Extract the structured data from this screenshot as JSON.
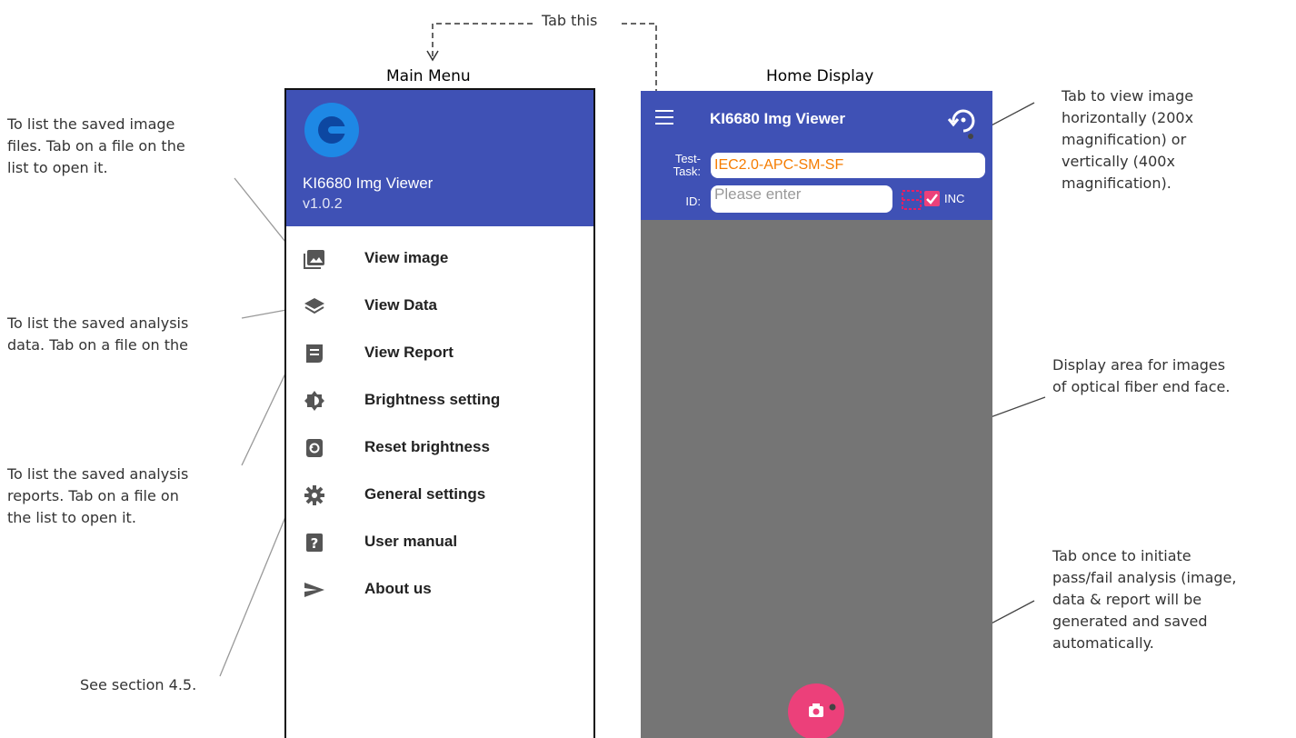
{
  "annotations": {
    "tab_this": "Tab this",
    "left_note_image": [
      "To list the saved image",
      "files. Tab on a file on the",
      "list to open it."
    ],
    "left_note_data": [
      "To list the saved analysis",
      "data. Tab on a file on the"
    ],
    "left_note_report": [
      "To list the saved analysis",
      "reports. Tab on a file on",
      "the list to open it."
    ],
    "left_note_section": "See section 4.5.",
    "right_note_rotate": [
      "Tab to view image",
      "horizontally (200x",
      "magnification) or",
      "vertically (400x",
      "magnification)."
    ],
    "right_note_display": [
      "Display area for images",
      "of optical fiber end face."
    ],
    "right_note_capture": [
      "Tab once to initiate",
      "pass/fail analysis (image,",
      "data & report will be",
      "generated and saved",
      "automatically."
    ]
  },
  "captions": {
    "main_menu": "Main Menu",
    "home_display": "Home Display"
  },
  "menu": {
    "app_name": "KI6680 Img Viewer",
    "version": "v1.0.2",
    "items": [
      {
        "label": "View image",
        "icon": "image-icon"
      },
      {
        "label": "View Data",
        "icon": "layers-icon"
      },
      {
        "label": "View Report",
        "icon": "report-icon"
      },
      {
        "label": "Brightness setting",
        "icon": "brightness-icon"
      },
      {
        "label": "Reset brightness",
        "icon": "reset-brightness-icon"
      },
      {
        "label": "General settings",
        "icon": "gear-icon"
      },
      {
        "label": "User manual",
        "icon": "help-icon"
      },
      {
        "label": "About us",
        "icon": "send-icon"
      }
    ]
  },
  "home": {
    "title": "KI6680 Img Viewer",
    "test_task_label": [
      "Test-",
      "Task:"
    ],
    "test_task_value": "IEC2.0-APC-SM-SF",
    "id_label": "ID:",
    "id_placeholder": "Please enter",
    "inc_label": "INC"
  },
  "colors": {
    "primary": "#3f51b5",
    "accent": "#ec407a",
    "display": "#757575",
    "task_text": "#f57c00"
  }
}
